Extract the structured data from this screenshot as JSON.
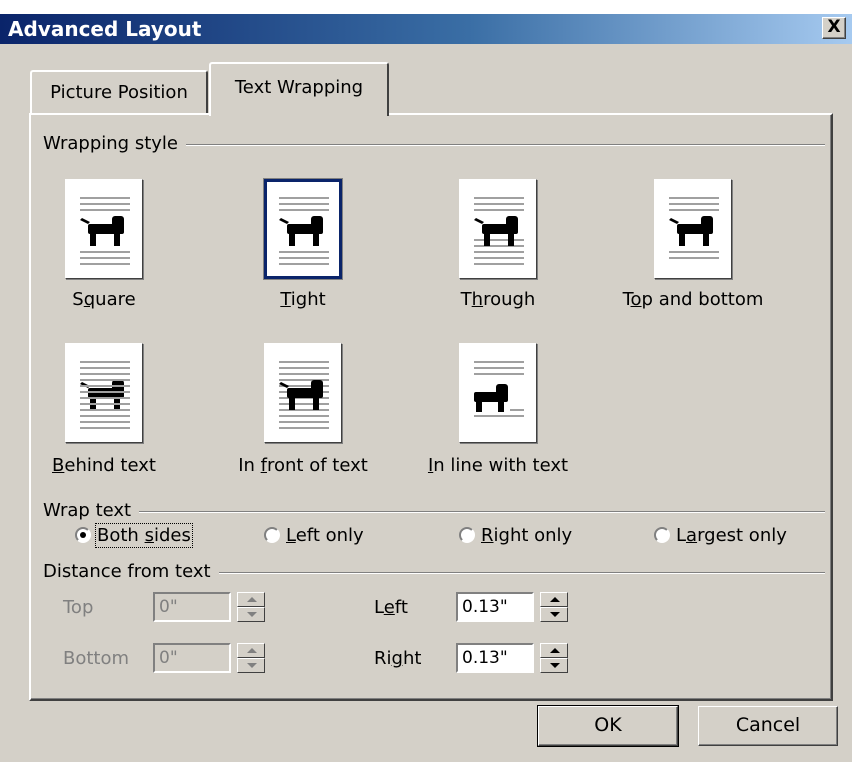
{
  "window": {
    "title": "Advanced Layout",
    "close_symbol": "X"
  },
  "tabs": [
    {
      "label": "Picture Position",
      "active": false
    },
    {
      "label": "Text Wrapping",
      "active": true
    }
  ],
  "wrapping_style": {
    "label": "Wrapping style",
    "options": [
      {
        "label_pre": "S",
        "label_key": "q",
        "label_post": "uare",
        "icon": "square-wrap-icon",
        "selected": false
      },
      {
        "label_pre": "",
        "label_key": "T",
        "label_post": "ight",
        "icon": "tight-wrap-icon",
        "selected": true
      },
      {
        "label_pre": "T",
        "label_key": "h",
        "label_post": "rough",
        "icon": "through-wrap-icon",
        "selected": false
      },
      {
        "label_pre": "T",
        "label_key": "o",
        "label_post": "p and bottom",
        "icon": "top-bottom-wrap-icon",
        "selected": false
      },
      {
        "label_pre": "",
        "label_key": "B",
        "label_post": "ehind text",
        "icon": "behind-text-icon",
        "selected": false
      },
      {
        "label_pre": "In ",
        "label_key": "f",
        "label_post": "ront of text",
        "icon": "in-front-of-text-icon",
        "selected": false
      },
      {
        "label_pre": "",
        "label_key": "I",
        "label_post": "n line with text",
        "icon": "in-line-with-text-icon",
        "selected": false
      }
    ]
  },
  "wrap_text": {
    "label": "Wrap text",
    "options": [
      {
        "label_pre": "Both ",
        "label_key": "s",
        "label_post": "ides",
        "checked": true
      },
      {
        "label_pre": "",
        "label_key": "L",
        "label_post": "eft only",
        "checked": false
      },
      {
        "label_pre": "",
        "label_key": "R",
        "label_post": "ight only",
        "checked": false
      },
      {
        "label_pre": "L",
        "label_key": "a",
        "label_post": "rgest only",
        "checked": false
      }
    ]
  },
  "distance": {
    "label": "Distance from text",
    "top": {
      "label": "Top",
      "value": "0\"",
      "enabled": false
    },
    "bottom": {
      "label": "Bottom",
      "value": "0\"",
      "enabled": false
    },
    "left": {
      "label_pre": "L",
      "label_key": "e",
      "label_post": "ft",
      "value": "0.13\"",
      "enabled": true
    },
    "right": {
      "label_pre": "Ri",
      "label_key": "g",
      "label_post": "ht",
      "value": "0.13\"",
      "enabled": true
    }
  },
  "buttons": {
    "ok": "OK",
    "cancel": "Cancel"
  },
  "colors": {
    "dialog_bg": "#d4d0c8",
    "title_start": "#0a246a",
    "title_end": "#a6caf0",
    "selection": "#0a246a"
  }
}
